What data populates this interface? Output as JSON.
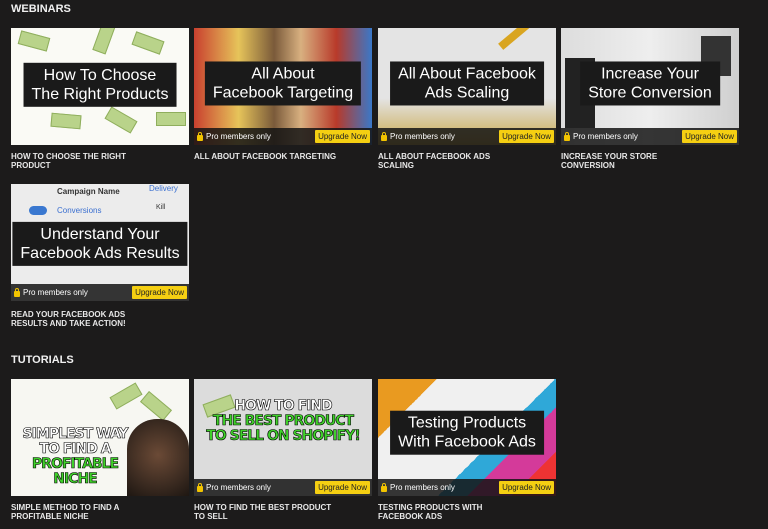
{
  "sections": [
    {
      "heading": "WEBINARS",
      "cards": [
        {
          "thumb_text": [
            "How To Choose",
            "The Right Products"
          ],
          "title": "How to choose the right product",
          "locked": false
        },
        {
          "thumb_text": [
            "All About",
            "Facebook Targeting"
          ],
          "title": "All about Facebook targeting",
          "locked": true
        },
        {
          "thumb_text": [
            "All About Facebook",
            "Ads Scaling"
          ],
          "title": "All about Facebook ads scaling",
          "locked": true
        },
        {
          "thumb_text": [
            "Increase Your",
            "Store Conversion"
          ],
          "title": "Increase your store conversion",
          "locked": true
        },
        {
          "thumb_text": [
            "Understand Your",
            "Facebook Ads Results"
          ],
          "title": "Read your Facebook ads results and take action!",
          "locked": true,
          "bg_text": [
            "Campaign Name",
            "Delivery",
            "Conversions",
            "Kill"
          ]
        }
      ]
    },
    {
      "heading": "TUTORIALS",
      "cards": [
        {
          "thumb_text": [
            "SIMPLEST WAY",
            "TO FIND A",
            "PROFITABLE NICHE"
          ],
          "title": "Simple method to find a profitable niche",
          "locked": false
        },
        {
          "thumb_text": [
            "HOW TO FIND",
            "THE BEST PRODUCT",
            "TO SELL ON SHOPIFY!"
          ],
          "title": "How to find the best product to sell",
          "locked": true
        },
        {
          "thumb_text": [
            "Testing Products",
            "With Facebook Ads"
          ],
          "title": "Testing products with Facebook ads",
          "locked": true
        }
      ]
    }
  ],
  "pro_label": "Pro members only",
  "upgrade_label": "Upgrade Now",
  "colors": {
    "background": "#1c1b1b",
    "upgrade": "#f5cf12",
    "lock": "#f2c400",
    "meme_green": "#3fd12a"
  },
  "icons": {
    "lock": "lock-icon"
  }
}
